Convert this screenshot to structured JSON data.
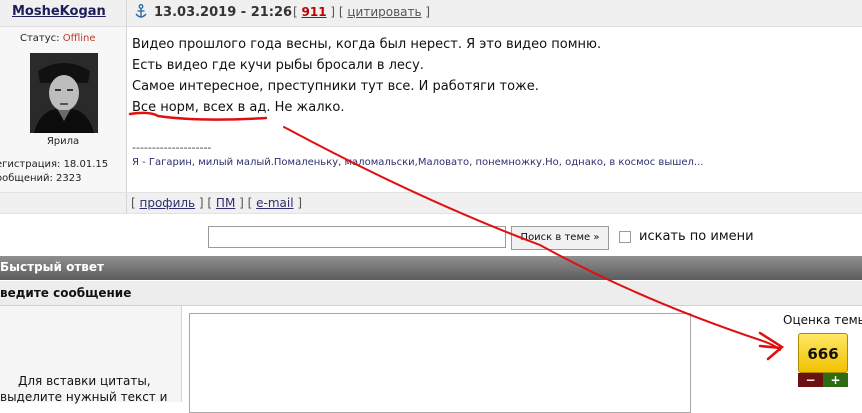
{
  "post": {
    "author": "MosheKogan",
    "date": "13.03.2019 - 21:26",
    "post_number": "911",
    "quote_label": "цитировать",
    "status_label": "Статус:",
    "status_value": "Offline",
    "avatar_caption": "Ярила",
    "reg_line": "егистрация: 18.01.15",
    "posts_line": "ообщений: 2323",
    "lines": [
      "Видео прошлого года весны, когда был нерест. Я это видео помню.",
      "Есть видео где кучи рыбы бросали в лесу.",
      "Самое интересное, преступники тут все. И работяги тоже.",
      "Все норм, всех в ад. Не жалко."
    ],
    "signature_separator": "--------------------",
    "signature": "Я - Гагарин, милый малый.Помаленьку, маломальски,Маловато, понемножку.Но, однако, в космос вышел..."
  },
  "footer_links": {
    "profile": "профиль",
    "pm": "ПМ",
    "email": "e-mail"
  },
  "search": {
    "button": "Поиск в теме »",
    "by_name_label": "искать по имени"
  },
  "quick_reply": {
    "title": "Быстрый ответ",
    "message_title": "ведите сообщение",
    "hint_line1": "Для вставки цитаты,",
    "hint_line2": "выделите нужный текст и"
  },
  "rating": {
    "label": "Оценка темы",
    "value": "666",
    "minus": "−",
    "plus": "+"
  },
  "colors": {
    "annotation_red": "#e01010",
    "rating_yellow": "#f5c800"
  }
}
